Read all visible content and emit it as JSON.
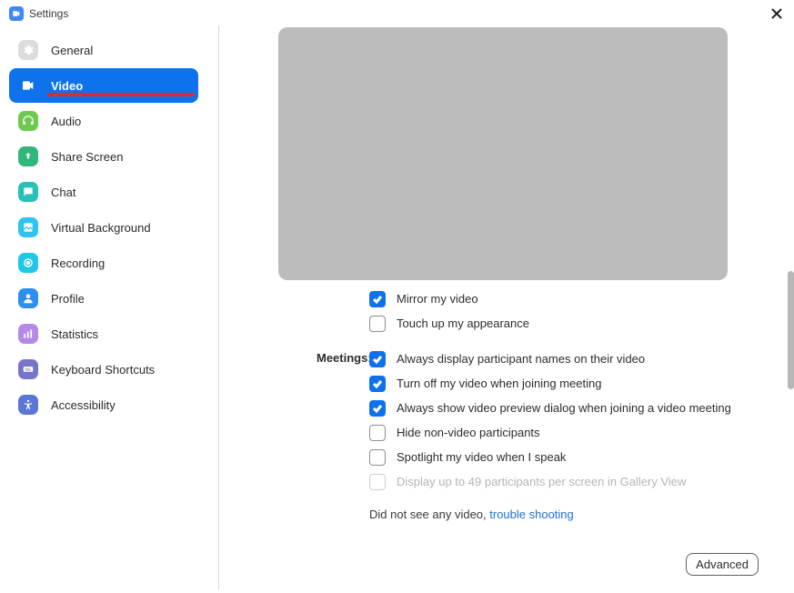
{
  "titlebar": {
    "title": "Settings"
  },
  "sidebar": {
    "items": [
      {
        "label": "General"
      },
      {
        "label": "Video"
      },
      {
        "label": "Audio"
      },
      {
        "label": "Share Screen"
      },
      {
        "label": "Chat"
      },
      {
        "label": "Virtual Background"
      },
      {
        "label": "Recording"
      },
      {
        "label": "Profile"
      },
      {
        "label": "Statistics"
      },
      {
        "label": "Keyboard Shortcuts"
      },
      {
        "label": "Accessibility"
      }
    ]
  },
  "content": {
    "meetings_label": "Meetings:",
    "options": {
      "mirror": {
        "label": "Mirror my video"
      },
      "touchup": {
        "label": "Touch up my appearance"
      },
      "show_names": {
        "label": "Always display participant names on their video"
      },
      "video_off_join": {
        "label": "Turn off my video when joining meeting"
      },
      "show_preview": {
        "label": "Always show video preview dialog when joining a video meeting"
      },
      "hide_nonvideo": {
        "label": "Hide non-video participants"
      },
      "spotlight": {
        "label": "Spotlight my video when I speak"
      },
      "gallery49": {
        "label": "Display up to 49 participants per screen in Gallery View"
      }
    },
    "no_video_text": "Did not see any video,  ",
    "troubleshoot_link": "trouble shooting",
    "advanced_label": "Advanced"
  }
}
